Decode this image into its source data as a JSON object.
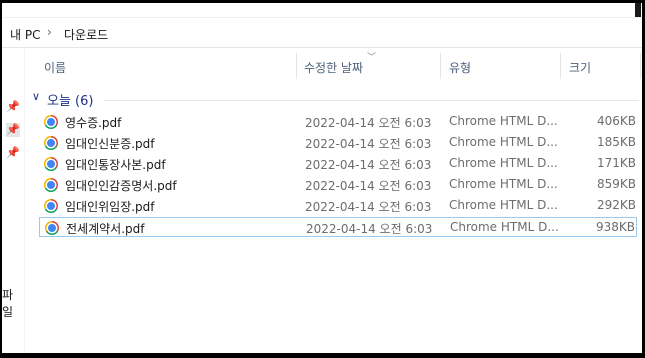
{
  "breadcrumb": {
    "root": "내 PC",
    "separator": "›",
    "folder": "다운로드"
  },
  "nav": {
    "partial_label": "파일"
  },
  "columns": {
    "name": "이름",
    "modified": "수정한 날짜",
    "type": "유형",
    "size": "크기"
  },
  "group": {
    "label": "오늘 (6)"
  },
  "files": [
    {
      "name": "영수증.pdf",
      "modified": "2022-04-14 오전 6:03",
      "type": "Chrome HTML D...",
      "size": "406KB",
      "icon": "chrome-icon"
    },
    {
      "name": "임대인신분증.pdf",
      "modified": "2022-04-14 오전 6:03",
      "type": "Chrome HTML D...",
      "size": "185KB",
      "icon": "chrome-icon"
    },
    {
      "name": "임대인통장사본.pdf",
      "modified": "2022-04-14 오전 6:03",
      "type": "Chrome HTML D...",
      "size": "171KB",
      "icon": "chrome-icon"
    },
    {
      "name": "임대인인감증명서.pdf",
      "modified": "2022-04-14 오전 6:03",
      "type": "Chrome HTML D...",
      "size": "859KB",
      "icon": "chrome-icon"
    },
    {
      "name": "임대인위임장.pdf",
      "modified": "2022-04-14 오전 6:03",
      "type": "Chrome HTML D...",
      "size": "292KB",
      "icon": "chrome-icon"
    },
    {
      "name": "전세계약서.pdf",
      "modified": "2022-04-14 오전 6:03",
      "type": "Chrome HTML D...",
      "size": "938KB",
      "icon": "chrome-icon",
      "selected": true
    }
  ]
}
